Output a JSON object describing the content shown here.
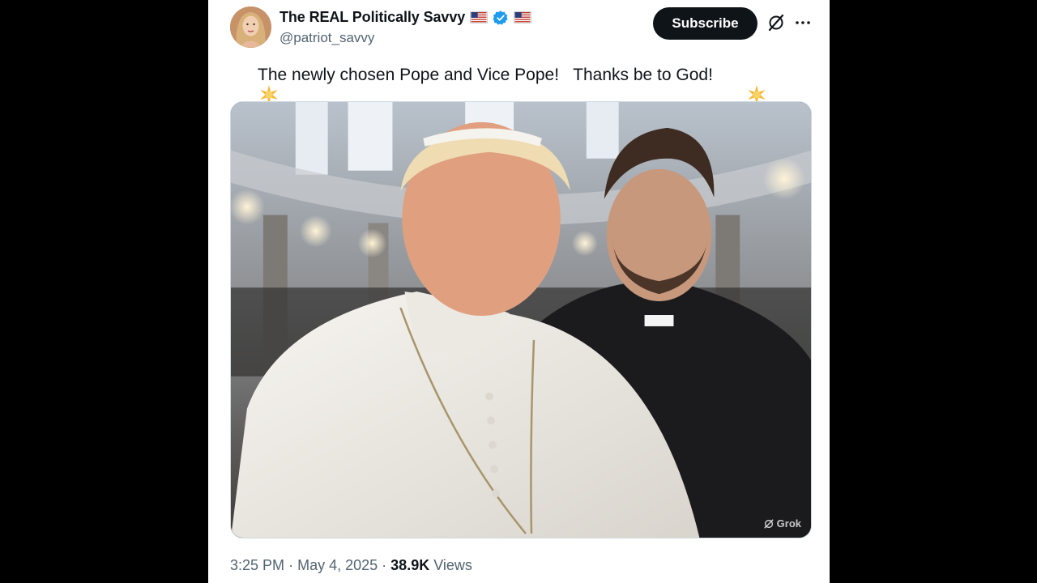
{
  "post": {
    "display_name": "The REAL Politically Savvy",
    "handle": "@patriot_savvy",
    "subscribe_label": "Subscribe",
    "text": "The newly chosen Pope and Vice Pope!   Thanks be to God!",
    "emoji_left": "star-sparkle-icon",
    "emoji_right": "star-sparkle-icon",
    "media_watermark": "Grok",
    "time": "3:25 PM",
    "date": "May 4, 2025",
    "views_count": "38.9K",
    "views_label": "Views",
    "separator": "·"
  },
  "icons": {
    "verified": "verified-badge-icon",
    "flag": "us-flag-icon",
    "grok": "grok-icon",
    "more": "more-icon"
  },
  "colors": {
    "background": "#000000",
    "card": "#ffffff",
    "text_primary": "#0f1419",
    "text_secondary": "#536471",
    "subscribe_bg": "#0f1419",
    "verified_blue": "#1d9bf0"
  }
}
